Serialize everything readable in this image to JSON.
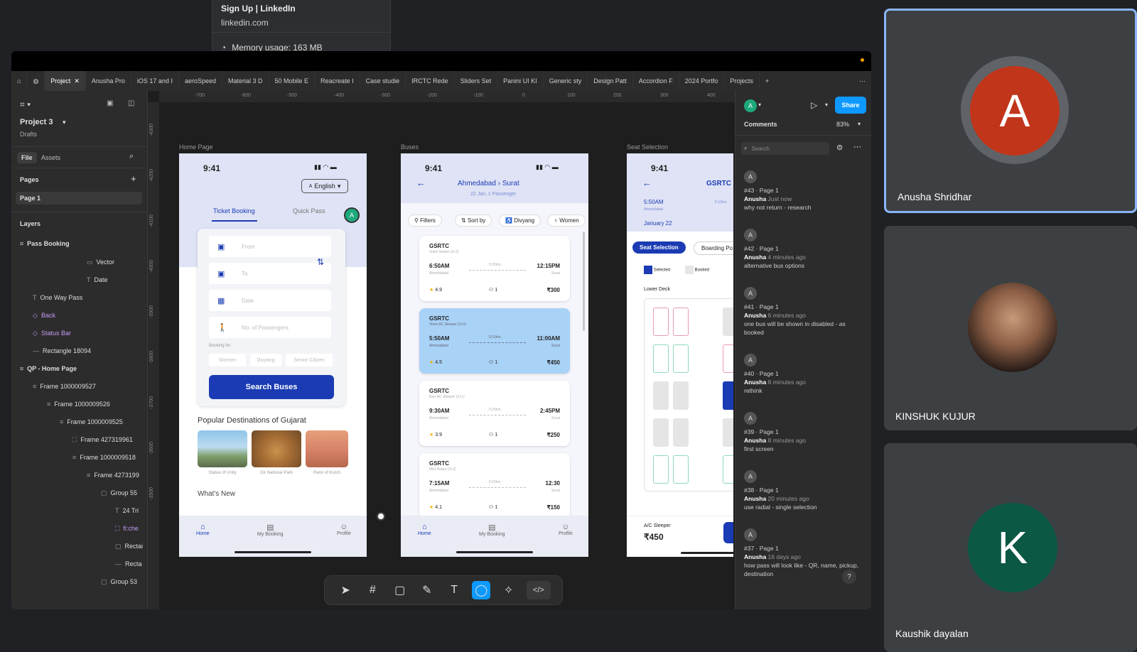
{
  "tooltip": {
    "title": "Sign Up | LinkedIn",
    "url": "linkedin.com",
    "memory": "Memory usage: 163 MB"
  },
  "tabs": [
    "Project",
    "Anusha Pro",
    "iOS 17 and I",
    "aeroSpeed",
    "Material 3 D",
    "50 Mobile E",
    "Reacreate I",
    "Case studie",
    "IRCTC Rede",
    "Sliders Set",
    "Panini UI KI",
    "Generic sty",
    "Design Patt",
    "Accordion F",
    "2024 Portfo",
    "Projects"
  ],
  "ruler": [
    "-700",
    "-600",
    "-500",
    "-400",
    "-300",
    "-200",
    "-100",
    "0",
    "100",
    "200",
    "300",
    "400"
  ],
  "vruler": [
    "-4300",
    "-4200",
    "-4100",
    "-4000",
    "-3900",
    "-3800",
    "-3700",
    "-3600",
    "-3500"
  ],
  "left": {
    "project": "Project 3",
    "drafts": "Drafts",
    "file": "File",
    "assets": "Assets",
    "pages": "Pages",
    "page1": "Page 1",
    "layers": "Layers",
    "layerItems": [
      "Pass Booking",
      "Vector",
      "Date",
      "One Way Pass",
      "Back",
      "Status Bar",
      "Rectangle 18094",
      "QP - Home Page",
      "Frame 1000009527",
      "Frame 1000009526",
      "Frame 1000009525",
      "Frame 427319961",
      "Frame 1000009518",
      "Frame 4273199",
      "Group 55",
      "24 Tri",
      "fi:che",
      "Rectai",
      "Recta",
      "Group 53"
    ]
  },
  "frames": {
    "home": "Home Page",
    "buses": "Buses",
    "seat": "Seat Selection"
  },
  "home": {
    "time": "9:41",
    "lang": "English",
    "tab1": "Ticket Booking",
    "tab2": "Quick Pass",
    "avatar": "A",
    "from": "From",
    "to": "To",
    "date": "Date",
    "passengers": "No. of Passengers",
    "bookingFor": "Booking for",
    "opt1": "Women",
    "opt2": "Divyang",
    "opt3": "Senior Citizen",
    "search": "Search Buses",
    "popular": "Popular Destinations of Gujarat",
    "d1": "Statue of Unity",
    "d2": "Gir National Park",
    "d3": "Rann of Kutch",
    "whatsNew": "What's New",
    "nav1": "Home",
    "nav2": "My Booking",
    "nav3": "Profile"
  },
  "buses": {
    "time": "9:41",
    "from": "Ahmedabad",
    "to": "Surat",
    "sub": "22 Jan, 1 Passenger",
    "filters": "Filters",
    "sort": "Sort by",
    "divyang": "Divyang",
    "women": "Women",
    "cards": [
      {
        "op": "GSRTC",
        "type": "Volvo Seater (2+2)",
        "dep": "6:50AM",
        "arr": "12:15PM",
        "dur": "5:20hrs",
        "from": "Ahmedabad",
        "to": "Surat",
        "rating": "4.9",
        "seats": "1",
        "price": "₹300"
      },
      {
        "op": "GSRTC",
        "type": "Volvo AC Sleeper (2+1)",
        "dep": "5:50AM",
        "arr": "11:00AM",
        "dur": "5:10hrs",
        "from": "Ahmedabad",
        "to": "Surat",
        "rating": "4.5",
        "seats": "1",
        "price": "₹450"
      },
      {
        "op": "GSRTC",
        "type": "Non-AC Sleeper (2+1)",
        "dep": "9:30AM",
        "arr": "2:45PM",
        "dur": "5:15hrs",
        "from": "Ahmedabad",
        "to": "Surat",
        "rating": "3.9",
        "seats": "1",
        "price": "₹250"
      },
      {
        "op": "GSRTC",
        "type": "Mini Buses (3+2)",
        "dep": "7:15AM",
        "arr": "12:30",
        "dur": "5:15hrs",
        "from": "Ahmedabad",
        "to": "Surat",
        "rating": "4.1",
        "seats": "1",
        "price": "₹150"
      }
    ],
    "nav1": "Home",
    "nav2": "My Booking",
    "nav3": "Profile"
  },
  "seat": {
    "time": "9:41",
    "op": "GSRTC",
    "dep": "5:50AM",
    "from": "Ahmedabad",
    "dur": "5:10hrs",
    "date": "January 22",
    "tab1": "Seat Selection",
    "tab2": "Boarding Po",
    "sel": "Selected",
    "booked": "Booked",
    "deck": "Lower Deck",
    "type": "A/C Sleeper",
    "price": "₹450"
  },
  "right": {
    "avatar": "A",
    "share": "Share",
    "comments": "Comments",
    "zoom": "83%",
    "search": "Search",
    "items": [
      {
        "id": "#43 · Page 1",
        "author": "Anusha",
        "time": "Just now",
        "text": "why not return - research"
      },
      {
        "id": "#42 · Page 1",
        "author": "Anusha",
        "time": "4 minutes ago",
        "text": "alternative bus options"
      },
      {
        "id": "#41 · Page 1",
        "author": "Anusha",
        "time": "6 minutes ago",
        "text": "one bus will be shown in disabled - as booked"
      },
      {
        "id": "#40 · Page 1",
        "author": "Anusha",
        "time": "8 minutes ago",
        "text": "rethink"
      },
      {
        "id": "#39 · Page 1",
        "author": "Anusha",
        "time": "8 minutes ago",
        "text": "first screen"
      },
      {
        "id": "#38 · Page 1",
        "author": "Anusha",
        "time": "20 minutes ago",
        "text": "use radial - single selection"
      },
      {
        "id": "#37 · Page 1",
        "author": "Anusha",
        "time": "16 days ago",
        "text": "how pass will look like - QR, name, pickup, destination"
      }
    ]
  },
  "participants": [
    {
      "name": "Anusha Shridhar",
      "initial": "A",
      "color": "#c1351a"
    },
    {
      "name": "KINSHUK KUJUR"
    },
    {
      "name": "Kaushik dayalan",
      "initial": "K",
      "color": "#0b5845"
    }
  ],
  "colors": {
    "accent": "#0d99ff",
    "primary": "#1a3bb3"
  }
}
